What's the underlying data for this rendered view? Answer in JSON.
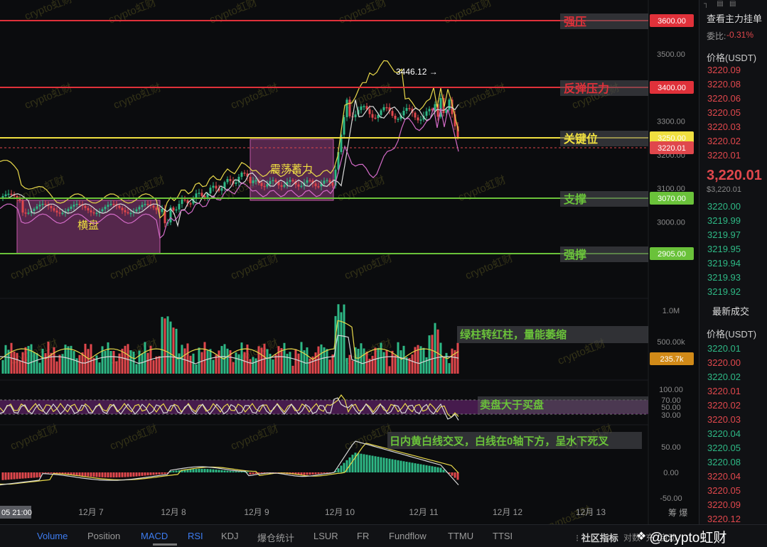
{
  "levels": [
    {
      "name": "strong-resistance",
      "label": "强压",
      "price": 3600.0,
      "price_text": "3600.00",
      "color": "#e0313a",
      "text_color": "#e0313a"
    },
    {
      "name": "rebound-resistance",
      "label": "反弹压力",
      "price": 3400.0,
      "price_text": "3400.00",
      "color": "#e0313a",
      "text_color": "#e0313a"
    },
    {
      "name": "key-level",
      "label": "关键位",
      "price": 3250.0,
      "price_text": "3250.00",
      "color": "#f0e040",
      "text_color": "#f0e040"
    },
    {
      "name": "support",
      "label": "支撑",
      "price": 3070.0,
      "price_text": "3070.00",
      "color": "#6ac23a",
      "text_color": "#6ac23a"
    },
    {
      "name": "strong-support",
      "label": "强撑",
      "price": 2905.0,
      "price_text": "2905.00",
      "color": "#6ac23a",
      "text_color": "#6ac23a"
    }
  ],
  "current_price_label": "3220.01",
  "price_axis": [
    "3500.00",
    "3300.00",
    "3200.00",
    "3100.00",
    "3000.00"
  ],
  "high_marker": "3446.12",
  "boxes": [
    {
      "name": "sideways-box",
      "label": "横盘"
    },
    {
      "name": "consolidation-box",
      "label": "震荡蓄力"
    }
  ],
  "volume": {
    "axis": [
      "1.0M",
      "500.00k"
    ],
    "current": "235.7k",
    "annotation": "绿柱转红柱，量能萎缩"
  },
  "rsi": {
    "axis": [
      "100.00",
      "70.00",
      "50.00",
      "30.00"
    ],
    "annotation": "卖盘大于买盘"
  },
  "macd": {
    "axis": [
      "50.00",
      "0.00",
      "-50.00"
    ],
    "annotation": "日内黄白线交叉，白线在0轴下方，呈水下死叉"
  },
  "time_axis": {
    "cursor": "05 21:00",
    "dates": [
      "12月 7",
      "12月 8",
      "12月 9",
      "12月 10",
      "12月 11",
      "12月 12",
      "12月 13"
    ],
    "right": "筹 爆"
  },
  "watermark": "crypto虹财",
  "right_panel": {
    "title": "查看主力挂单",
    "ratio_label": "委比:",
    "ratio_value": "-0.31%",
    "price_header": "价格(USDT)",
    "asks": [
      "3220.09",
      "3220.08",
      "3220.06",
      "3220.05",
      "3220.03",
      "3220.02",
      "3220.01"
    ],
    "last_price": "3,220.01",
    "last_price_sub": "$3,220.01",
    "bids": [
      "3220.00",
      "3219.99",
      "3219.97",
      "3219.95",
      "3219.94",
      "3219.93",
      "3219.92"
    ],
    "trades_title": "最新成交",
    "trades_header": "价格(USDT)",
    "trades": [
      {
        "p": "3220.01",
        "c": "green"
      },
      {
        "p": "3220.00",
        "c": "red"
      },
      {
        "p": "3220.02",
        "c": "green"
      },
      {
        "p": "3220.01",
        "c": "red"
      },
      {
        "p": "3220.02",
        "c": "red"
      },
      {
        "p": "3220.03",
        "c": "red"
      },
      {
        "p": "3220.04",
        "c": "green"
      },
      {
        "p": "3220.05",
        "c": "green"
      },
      {
        "p": "3220.08",
        "c": "green"
      },
      {
        "p": "3220.04",
        "c": "red"
      },
      {
        "p": "3220.05",
        "c": "red"
      },
      {
        "p": "3220.09",
        "c": "red"
      },
      {
        "p": "3220.12",
        "c": "red"
      }
    ]
  },
  "bottom_tabs": [
    {
      "label": "Volume",
      "active": true
    },
    {
      "label": "Position",
      "active": false
    },
    {
      "label": "MACD",
      "active": true
    },
    {
      "label": "RSI",
      "active": true
    },
    {
      "label": "KDJ",
      "active": false
    },
    {
      "label": "爆仓统计",
      "active": false
    },
    {
      "label": "LSUR",
      "active": false
    },
    {
      "label": "FR",
      "active": false
    },
    {
      "label": "Fundflow",
      "active": false
    },
    {
      "label": "TTMU",
      "active": false
    },
    {
      "label": "TTSI",
      "active": false
    }
  ],
  "community_label": "社区指标",
  "bottom_right": [
    "对数",
    "充",
    "自动"
  ],
  "brand": "@crypto虹财",
  "colors": {
    "up": "#2eb885",
    "down": "#e0474c",
    "box": "#b04a9a"
  }
}
